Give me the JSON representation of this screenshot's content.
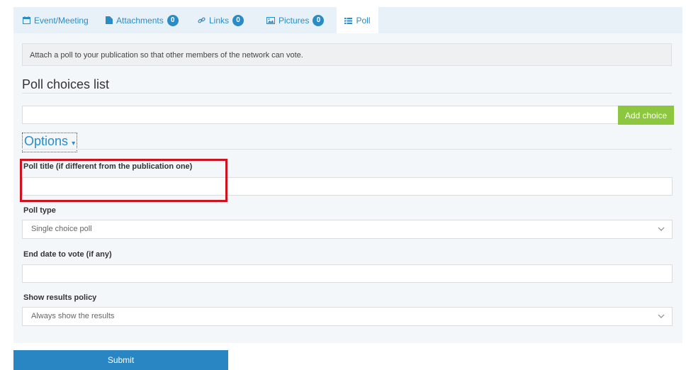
{
  "tabs": [
    {
      "label": "Event/Meeting",
      "icon": "calendar-icon"
    },
    {
      "label": "Attachments",
      "icon": "file-icon",
      "count": "0"
    },
    {
      "label": "Links",
      "icon": "link-icon",
      "count": "0"
    },
    {
      "label": "Pictures",
      "icon": "image-icon",
      "count": "0"
    },
    {
      "label": "Poll",
      "icon": "list-icon",
      "active": true
    }
  ],
  "info_text": "Attach a poll to your publication so that other members of the network can vote.",
  "choices": {
    "title": "Poll choices list",
    "input_value": "",
    "add_label": "Add choice"
  },
  "options": {
    "toggle_label": "Options",
    "poll_title_label": "Poll title (if different from the publication one)",
    "poll_title_value": "",
    "poll_type_label": "Poll type",
    "poll_type_value": "Single choice poll",
    "end_date_label": "End date to vote (if any)",
    "end_date_value": "",
    "results_label": "Show results policy",
    "results_value": "Always show the results"
  },
  "submit_label": "Submit",
  "colors": {
    "accent": "#2a8cc7",
    "add_button": "#8dc63f",
    "highlight": "#d0121e"
  }
}
